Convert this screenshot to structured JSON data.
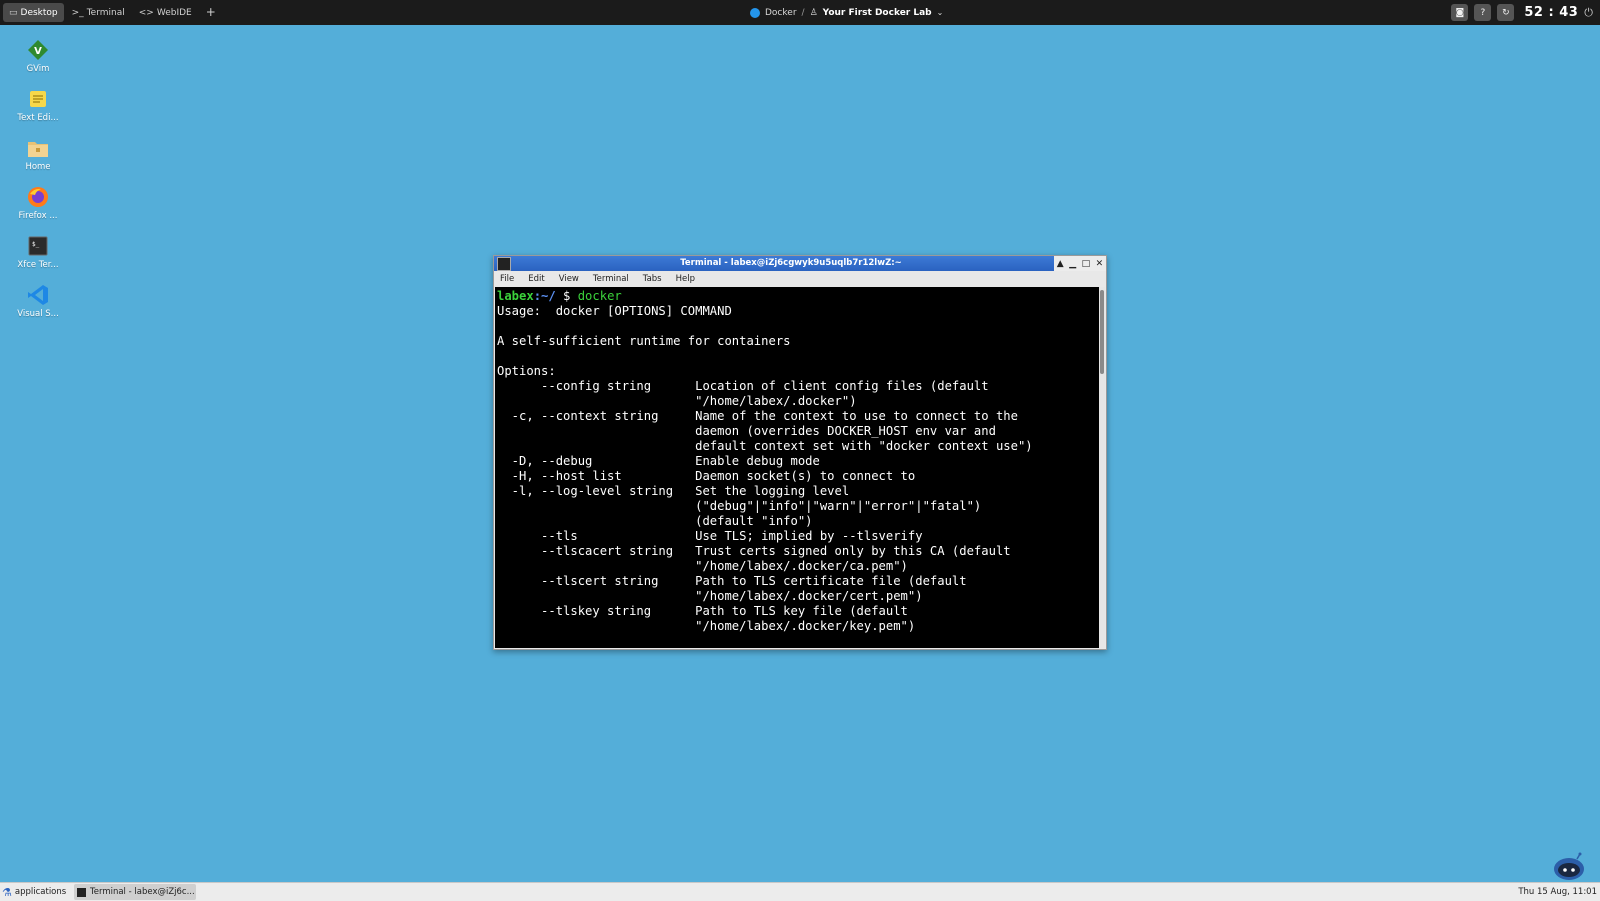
{
  "topbar": {
    "tabs": [
      {
        "label": "Desktop",
        "icon": "monitor-icon",
        "active": true
      },
      {
        "label": "Terminal",
        "icon": "terminal-prompt-icon",
        "active": false
      },
      {
        "label": "WebIDE",
        "icon": "code-icon",
        "active": false
      }
    ],
    "add_tab_label": "+",
    "breadcrumb": {
      "root": "Docker",
      "separator": "/",
      "lab": "Your First Docker Lab"
    },
    "timer": "52 : 43"
  },
  "desktop_icons": [
    {
      "label": "GVim",
      "icon": "gvim-icon"
    },
    {
      "label": "Text Edi...",
      "icon": "text-editor-icon"
    },
    {
      "label": "Home",
      "icon": "home-folder-icon"
    },
    {
      "label": "Firefox ...",
      "icon": "firefox-icon"
    },
    {
      "label": "Xfce Ter...",
      "icon": "terminal-icon"
    },
    {
      "label": "Visual S...",
      "icon": "vscode-icon"
    }
  ],
  "terminal_window": {
    "title": "Terminal - labex@iZj6cgwyk9u5uqlb7r12lwZ:~",
    "menu": [
      "File",
      "Edit",
      "View",
      "Terminal",
      "Tabs",
      "Help"
    ],
    "prompt_user": "labex",
    "prompt_path": ":~/",
    "prompt_symbol": " $ ",
    "command": "docker",
    "output": "\nUsage:  docker [OPTIONS] COMMAND\n\nA self-sufficient runtime for containers\n\nOptions:\n      --config string      Location of client config files (default\n                           \"/home/labex/.docker\")\n  -c, --context string     Name of the context to use to connect to the\n                           daemon (overrides DOCKER_HOST env var and\n                           default context set with \"docker context use\")\n  -D, --debug              Enable debug mode\n  -H, --host list          Daemon socket(s) to connect to\n  -l, --log-level string   Set the logging level\n                           (\"debug\"|\"info\"|\"warn\"|\"error\"|\"fatal\")\n                           (default \"info\")\n      --tls                Use TLS; implied by --tlsverify\n      --tlscacert string   Trust certs signed only by this CA (default\n                           \"/home/labex/.docker/ca.pem\")\n      --tlscert string     Path to TLS certificate file (default\n                           \"/home/labex/.docker/cert.pem\")\n      --tlskey string      Path to TLS key file (default\n                           \"/home/labex/.docker/key.pem\")"
  },
  "taskbar": {
    "applications_label": "applications",
    "task_item_label": "Terminal - labex@iZj6c...",
    "clock": "Thu 15 Aug, 11:01"
  },
  "colors": {
    "desktop_bg": "#54aed9",
    "topbar_bg": "#1b1b1b",
    "titlebar_blue": "#2a62c0",
    "prompt_green": "#3bd23b",
    "prompt_blue": "#5b8ff0"
  }
}
